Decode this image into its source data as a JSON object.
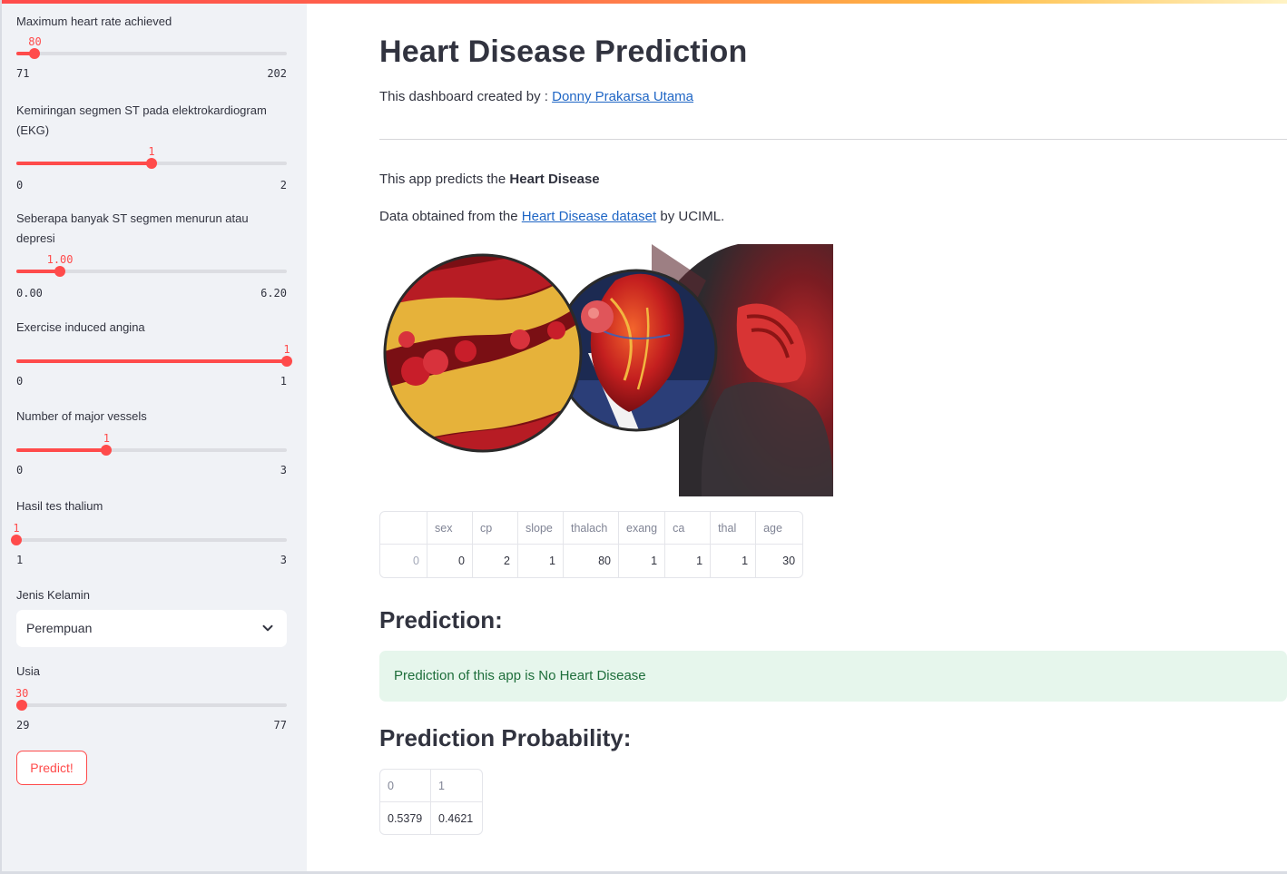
{
  "sidebar": {
    "sliders": [
      {
        "label": "Maximum heart rate achieved",
        "value": "80",
        "min": "71",
        "max": "202",
        "fraction": 0.0687
      },
      {
        "label": "Kemiringan segmen ST pada elektrokardiogram (EKG)",
        "value": "1",
        "min": "0",
        "max": "2",
        "fraction": 0.5
      },
      {
        "label": "Seberapa banyak ST segmen menurun atau depresi",
        "value": "1.00",
        "min": "0.00",
        "max": "6.20",
        "fraction": 0.1613
      },
      {
        "label": "Exercise induced angina",
        "value": "1",
        "min": "0",
        "max": "1",
        "fraction": 1.0
      },
      {
        "label": "Number of major vessels",
        "value": "1",
        "min": "0",
        "max": "3",
        "fraction": 0.3333
      },
      {
        "label": "Hasil tes thalium",
        "value": "1",
        "min": "1",
        "max": "3",
        "fraction": 0.0
      }
    ],
    "select": {
      "label": "Jenis Kelamin",
      "value": "Perempuan"
    },
    "age_slider": {
      "label": "Usia",
      "value": "30",
      "min": "29",
      "max": "77",
      "fraction": 0.0208
    },
    "predict_label": "Predict!"
  },
  "main": {
    "title": "Heart Disease Prediction",
    "byline_prefix": "This dashboard created by : ",
    "byline_link": "Donny Prakarsa Utama",
    "intro_prefix": "This app predicts the ",
    "intro_bold": "Heart Disease",
    "data_prefix": "Data obtained from the ",
    "data_link": "Heart Disease dataset",
    "data_suffix": " by UCIML.",
    "input_table": {
      "columns": [
        "",
        "sex",
        "cp",
        "slope",
        "thalach",
        "exang",
        "ca",
        "thal",
        "age"
      ],
      "rows": [
        [
          "0",
          "0",
          "2",
          "1",
          "80",
          "1",
          "1",
          "1",
          "30"
        ]
      ]
    },
    "prediction_heading": "Prediction:",
    "prediction_text": "Prediction of this app is No Heart Disease",
    "probability_heading": "Prediction Probability:",
    "probability_table": {
      "columns": [
        "0",
        "1"
      ],
      "rows": [
        [
          "0.5379",
          "0.4621"
        ]
      ]
    }
  },
  "colors": {
    "accent": "#ff4b4b",
    "sidebar_bg": "#f0f2f6",
    "link": "#1f66c5",
    "success_bg": "#e6f6ec",
    "success_text": "#1e6e3b"
  }
}
